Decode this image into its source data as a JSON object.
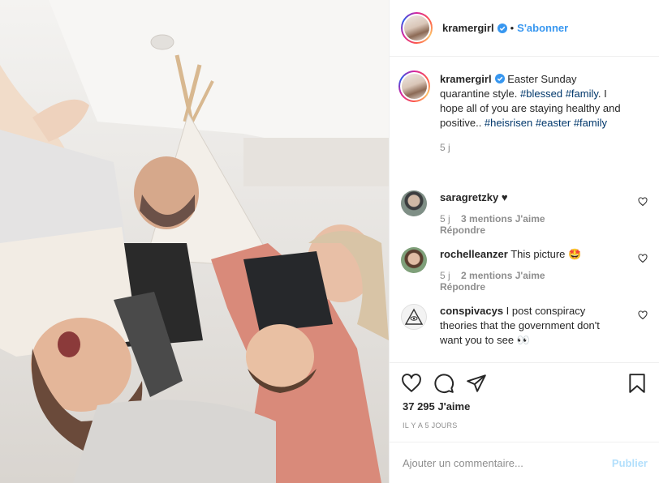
{
  "post": {
    "username": "kramergirl",
    "follow_label": "S'abonner",
    "separator": "•",
    "caption_parts": [
      "Easter Sunday quarantine style. ",
      "#blessed",
      " ",
      "#family",
      ". I hope all of you are staying healthy and positive.. ",
      "#heisrisen",
      " ",
      "#easter",
      " ",
      "#family"
    ],
    "caption_age": "5 j",
    "likes": "37 295 J'aime",
    "posted_ago": "IL Y A 5 JOURS"
  },
  "comments": [
    {
      "username": "saragretzky",
      "text": "♥",
      "age": "5 j",
      "likes": "3 mentions J'aime",
      "reply": "Répondre"
    },
    {
      "username": "rochelleanzer",
      "text": "This picture 🤩",
      "age": "5 j",
      "likes": "2 mentions J'aime",
      "reply": "Répondre"
    },
    {
      "username": "conspivacys",
      "text": "I post conspiracy theories that the government don't want you to see 👀"
    }
  ],
  "composer": {
    "placeholder": "Ajouter un commentaire...",
    "publish_label": "Publier"
  },
  "colors": {
    "accent": "#3897f0",
    "publish_disabled": "#b2dffc",
    "muted": "#8e8e8e",
    "text": "#262626",
    "hashtag": "#00376b",
    "verified": "#3897f0"
  },
  "icons": {
    "like": "heart-icon",
    "comment": "comment-icon",
    "share": "paper-plane-icon",
    "save": "bookmark-icon",
    "verified": "verified-badge-icon",
    "comment_like": "heart-outline-icon"
  }
}
